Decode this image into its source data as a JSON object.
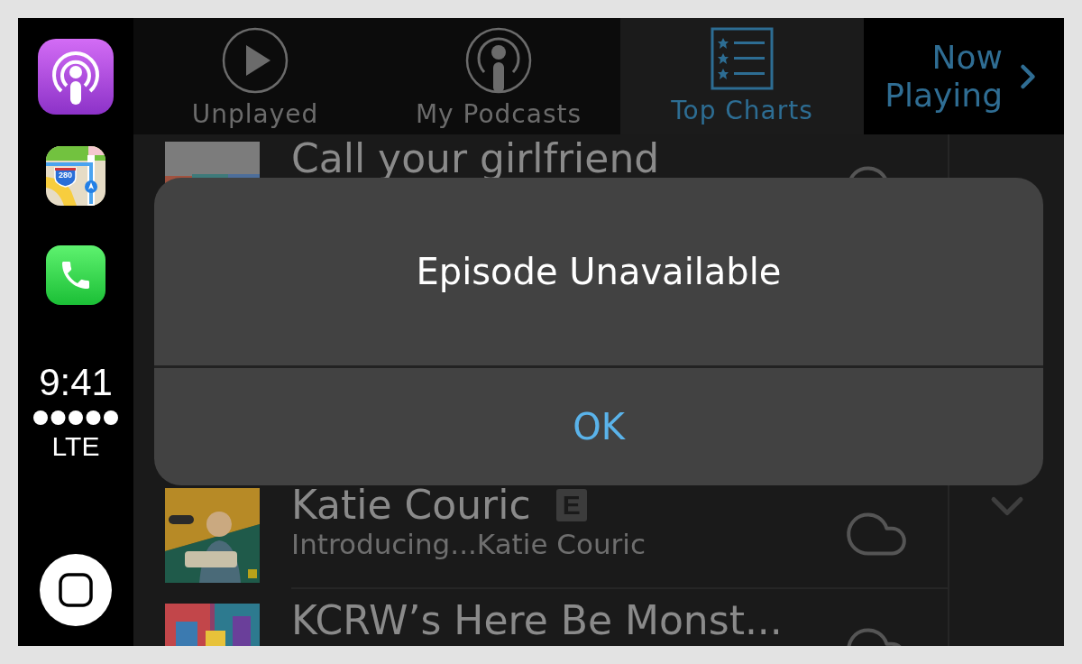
{
  "dock": {
    "apps": [
      {
        "kind": "podcasts"
      },
      {
        "kind": "maps",
        "shield": "280"
      },
      {
        "kind": "phone"
      }
    ],
    "time": "9:41",
    "network": "LTE"
  },
  "tabs": [
    {
      "label": "Unplayed",
      "kind": "play",
      "selected": false
    },
    {
      "label": "My Podcasts",
      "kind": "podcast",
      "selected": false
    },
    {
      "label": "Top Charts",
      "kind": "charts",
      "selected": true
    }
  ],
  "now_playing": "Now Playing",
  "episodes": [
    {
      "title": "Call your girlfriend"
    },
    {
      "title": "Katie Couric",
      "explicit": "E",
      "subtitle": "Introducing...Katie Couric"
    },
    {
      "title": "KCRW’s Here Be Monst..."
    }
  ],
  "alert": {
    "title": "Episode Unavailable",
    "buttons": [
      "OK"
    ]
  }
}
